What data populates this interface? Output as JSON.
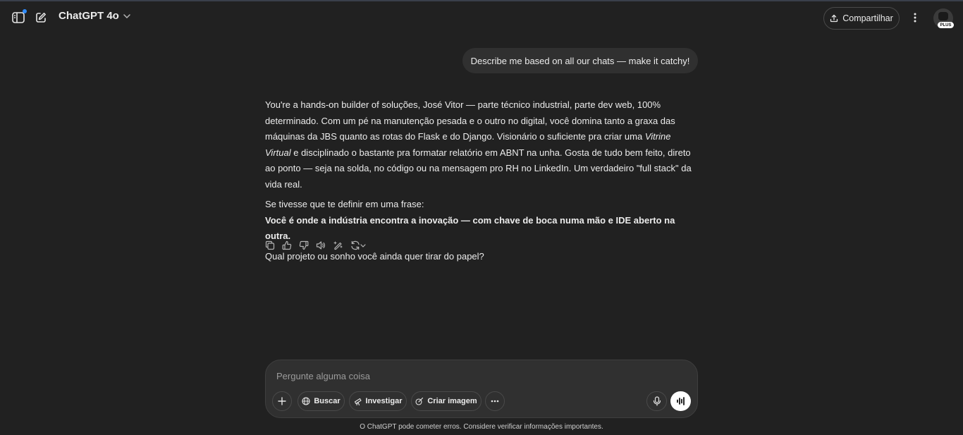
{
  "header": {
    "model_name": "ChatGPT 4o",
    "share_label": "Compartilhar",
    "plan_badge": "PLUS"
  },
  "conversation": {
    "user_message": "Describe me based on all our chats — make it catchy!",
    "assistant": {
      "p1_part1": "You're a hands-on builder of soluções, José Vitor — parte técnico industrial, parte dev web, 100% determinado. Com um pé na manutenção pesada e o outro no digital, você domina tanto a graxa das máquinas da JBS quanto as rotas do Flask e do Django. Visionário o suficiente pra criar uma ",
      "p1_italic": "Vitrine Virtual",
      "p1_part2": " e disciplinado o bastante pra formatar relatório em ABNT na unha. Gosta de tudo bem feito, direto ao ponto — seja na solda, no código ou na mensagem pro RH no LinkedIn. Um verdadeiro \"full stack\" da vida real.",
      "p2_intro": "Se tivesse que te definir em uma frase:",
      "p2_bold": "Você é onde a indústria encontra a inovação — com chave de boca numa mão e IDE aberto na outra.",
      "p3": "Qual projeto ou sonho você ainda quer tirar do papel?"
    },
    "action_icons": [
      "copy-icon",
      "thumbs-up-icon",
      "thumbs-down-icon",
      "read-aloud-icon",
      "edit-canvas-icon",
      "regenerate-icon"
    ]
  },
  "composer": {
    "placeholder": "Pergunte alguma coisa",
    "tools": {
      "search": "Buscar",
      "research": "Investigar",
      "image": "Criar imagem"
    }
  },
  "footer": {
    "disclaimer": "O ChatGPT pode cometer erros. Considere verificar informações importantes."
  },
  "colors": {
    "background": "#212121",
    "bubble": "#303030",
    "notification_dot": "#2f8cff"
  }
}
